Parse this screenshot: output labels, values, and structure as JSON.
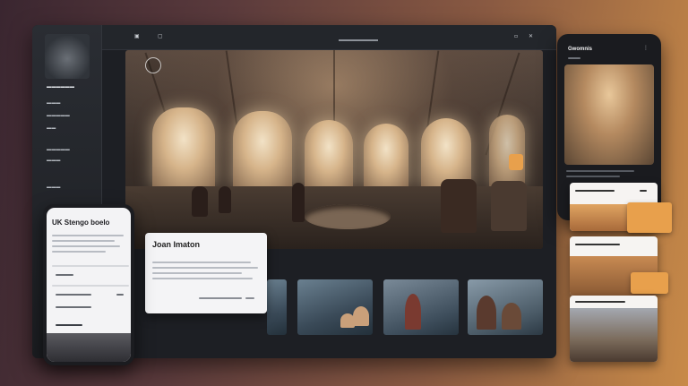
{
  "main_window": {
    "card": {
      "title": "Joan Imaton"
    }
  },
  "left_phone": {
    "title": "UK Stengo boelo"
  },
  "right_phone": {
    "title": "Gwomnis"
  },
  "colors": {
    "accent_orange": "#e8a04c",
    "window_bg": "#1d1f24",
    "card_bg": "#f4f4f6"
  },
  "icons": [
    "close-icon",
    "home-icon",
    "menu-icon",
    "expand-icon"
  ]
}
